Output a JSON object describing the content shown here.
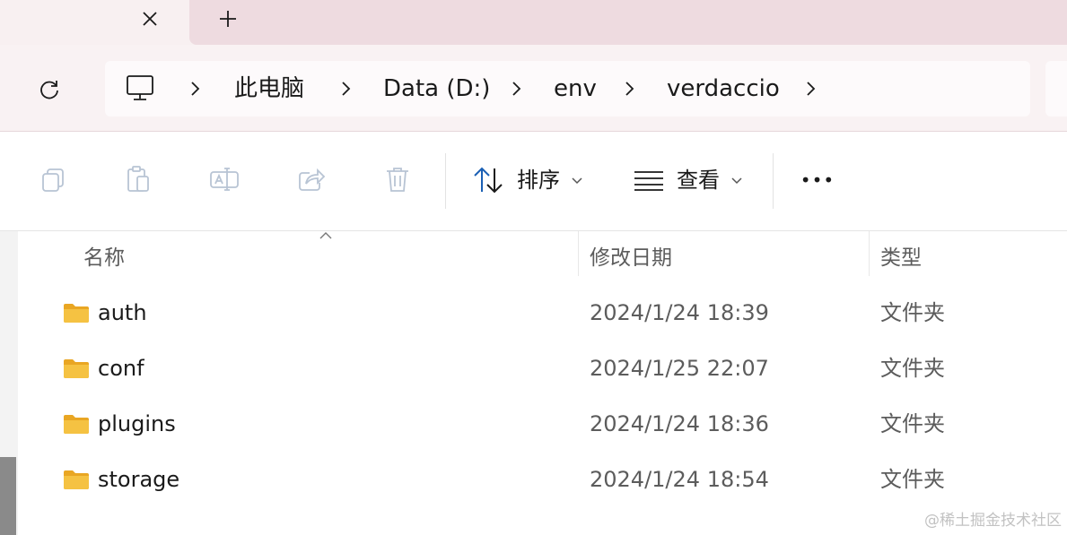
{
  "tabs": {
    "close_icon": "close-icon",
    "new_tab_icon": "plus-icon"
  },
  "navigation": {
    "refresh_icon": "refresh-icon",
    "breadcrumb": [
      {
        "label": "",
        "icon": "computer-icon"
      },
      {
        "label": "此电脑"
      },
      {
        "label": "Data (D:)"
      },
      {
        "label": "env"
      },
      {
        "label": "verdaccio"
      }
    ]
  },
  "toolbar": {
    "sort_label": "排序",
    "view_label": "查看",
    "more_label": "•••",
    "icons": [
      "copy-icon",
      "paste-icon",
      "rename-icon",
      "share-icon",
      "delete-icon",
      "sort-icon",
      "view-icon"
    ]
  },
  "file_list": {
    "columns": {
      "name": "名称",
      "modified": "修改日期",
      "type": "类型"
    },
    "rows": [
      {
        "name": "auth",
        "modified": "2024/1/24 18:39",
        "type": "文件夹"
      },
      {
        "name": "conf",
        "modified": "2024/1/25 22:07",
        "type": "文件夹"
      },
      {
        "name": "plugins",
        "modified": "2024/1/24 18:36",
        "type": "文件夹"
      },
      {
        "name": "storage",
        "modified": "2024/1/24 18:54",
        "type": "文件夹"
      }
    ]
  },
  "watermark": "@稀土掘金技术社区",
  "colors": {
    "folder": "#f5c242",
    "tab_background": "#eedbe0",
    "nav_background": "#f9f2f3",
    "icon_disabled": "#b8c4d4",
    "icon_active": "#1a5fb4"
  }
}
